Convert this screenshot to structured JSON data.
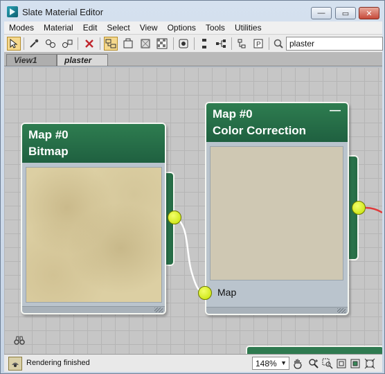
{
  "window": {
    "title": "Slate Material Editor",
    "minimize": "—",
    "maximize": "▭",
    "close": "✕"
  },
  "menu": [
    "Modes",
    "Material",
    "Edit",
    "Select",
    "View",
    "Options",
    "Tools",
    "Utilities"
  ],
  "toolbar": {
    "search_value": "plaster"
  },
  "tabs": [
    "View1",
    "plaster"
  ],
  "nodes": {
    "bitmap": {
      "id": "Map #0",
      "type": "Bitmap"
    },
    "color_correction": {
      "id": "Map #0",
      "type": "Color Correction",
      "collapse": "—",
      "slot_label": "Map"
    }
  },
  "status": {
    "text": "Rendering finished",
    "zoom": "148%"
  },
  "colors": {
    "node_header": "#2e7d50",
    "socket": "#d7f000",
    "wire": "#ffffff",
    "wire_out": "#e03a3a",
    "active_tool": "#f5d88c"
  }
}
